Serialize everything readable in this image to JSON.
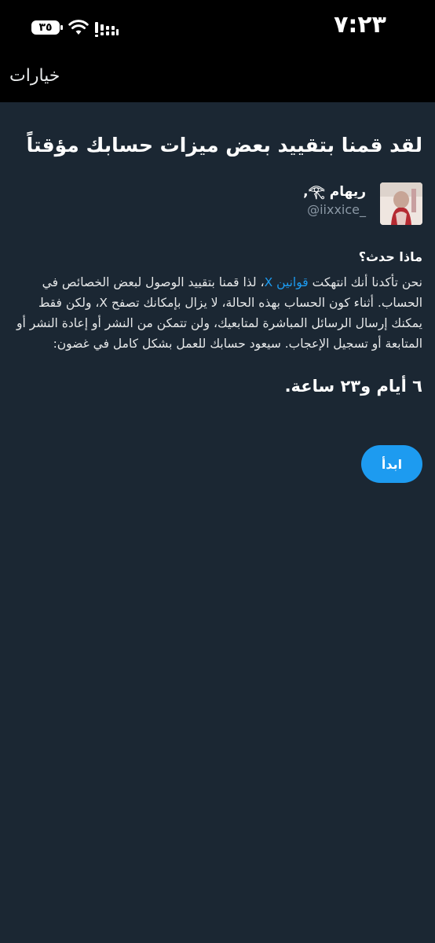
{
  "status_bar": {
    "time": "٧:٢٣",
    "battery": "٣٥"
  },
  "top_bar": {
    "options_label": "خيارات"
  },
  "restriction": {
    "headline": "لقد قمنا بتقييد بعض ميزات حسابك مؤقتاً",
    "account": {
      "display_name": "ريهام 𓂀,",
      "username": "@iixxice_"
    },
    "what_happened_title": "ماذا حدث؟",
    "body_before_link": "نحن تأكدنا أنك انتهكت ",
    "rules_link": "قوانين X",
    "body_after_link": "، لذا قمنا بتقييد الوصول لبعض الخصائص في الحساب. أثناء كون الحساب بهذه الحالة، لا يزال بإمكانك تصفح X، ولكن فقط يمكنك إرسال الرسائل المباشرة لمتابعيك، ولن تتمكن من النشر أو إعادة النشر أو المتابعة أو تسجيل الإعجاب. سيعود حسابك للعمل بشكل كامل في غضون:",
    "duration": "٦ أيام و٢٣ ساعة.",
    "start_button": "ابدأ"
  },
  "colors": {
    "background": "#1b2733",
    "accent": "#1d9bf0",
    "bar": "#000000"
  }
}
